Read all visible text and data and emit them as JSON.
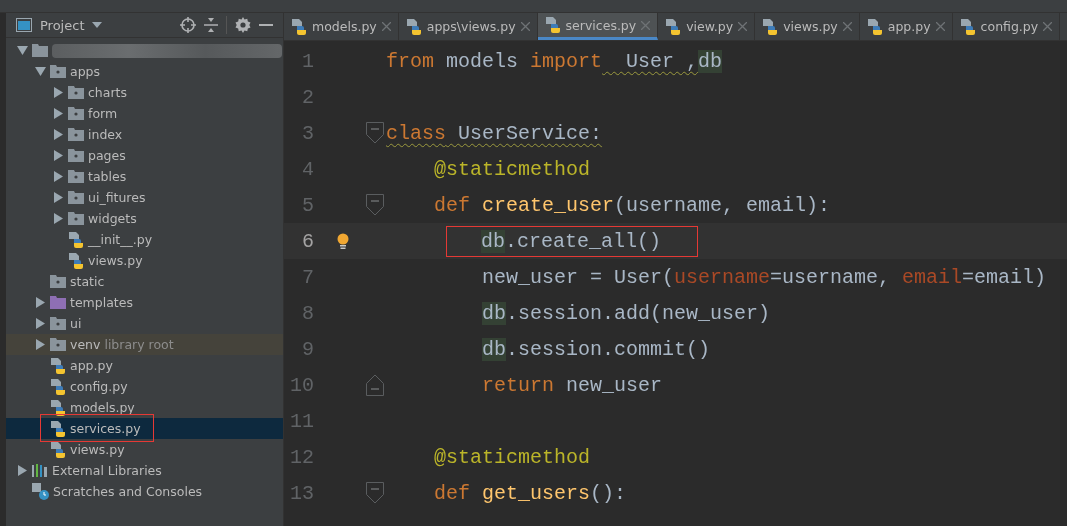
{
  "project_panel": {
    "title": "Project"
  },
  "tree": [
    {
      "kind": "redacted",
      "expanded": true,
      "selected": false,
      "children": [
        {
          "kind": "folder",
          "label": "apps",
          "expanded": true,
          "selected": false,
          "children": [
            {
              "kind": "folder",
              "label": "charts",
              "expanded": false,
              "selected": false
            },
            {
              "kind": "folder",
              "label": "form",
              "expanded": false,
              "selected": false
            },
            {
              "kind": "folder",
              "label": "index",
              "expanded": false,
              "selected": false
            },
            {
              "kind": "folder",
              "label": "pages",
              "expanded": false,
              "selected": false
            },
            {
              "kind": "folder",
              "label": "tables",
              "expanded": false,
              "selected": false
            },
            {
              "kind": "folder",
              "label": "ui_fitures",
              "expanded": false,
              "selected": false
            },
            {
              "kind": "folder",
              "label": "widgets",
              "expanded": false,
              "selected": false
            },
            {
              "kind": "file",
              "label": "__init__.py",
              "selected": false
            },
            {
              "kind": "file",
              "label": "views.py",
              "selected": false
            }
          ]
        },
        {
          "kind": "folder",
          "label": "static",
          "selected": false
        },
        {
          "kind": "template-folder",
          "label": "templates",
          "expanded": false,
          "selected": false
        },
        {
          "kind": "folder",
          "label": "ui",
          "expanded": false,
          "selected": false
        },
        {
          "kind": "folder",
          "label": "venv",
          "note": "library root",
          "expanded": false,
          "selected": false
        },
        {
          "kind": "file",
          "label": "app.py",
          "selected": false
        },
        {
          "kind": "file",
          "label": "config.py",
          "selected": false
        },
        {
          "kind": "file",
          "label": "models.py",
          "selected": false
        },
        {
          "kind": "file",
          "label": "services.py",
          "selected": true,
          "annotated": true
        },
        {
          "kind": "file",
          "label": "views.py",
          "selected": false
        }
      ]
    },
    {
      "kind": "libraries",
      "label": "External Libraries",
      "expanded": false,
      "selected": false
    },
    {
      "kind": "scratches",
      "label": "Scratches and Consoles",
      "selected": false
    }
  ],
  "tabs": [
    {
      "label": "models.py",
      "selected": false
    },
    {
      "label": "apps\\views.py",
      "selected": false
    },
    {
      "label": "services.py",
      "selected": true
    },
    {
      "label": "view.py",
      "selected": false
    },
    {
      "label": "views.py",
      "selected": false
    },
    {
      "label": "app.py",
      "selected": false
    },
    {
      "label": "config.py",
      "selected": false
    }
  ],
  "code_lines": [
    {
      "number": "1",
      "tokens": [
        {
          "text": "from",
          "kind": "keyword"
        },
        {
          "text": " models ",
          "kind": "plain"
        },
        {
          "text": "import",
          "kind": "keyword"
        },
        {
          "text": "  User ,",
          "kind": "plain",
          "warn": true
        },
        {
          "text": "db",
          "kind": "usage"
        }
      ]
    },
    {
      "number": "2"
    },
    {
      "number": "3",
      "fold_start": true,
      "tokens": [
        {
          "text": "class",
          "kind": "keyword",
          "warn": true
        },
        {
          "text": " UserService:",
          "kind": "plain",
          "warn": true
        }
      ],
      "children": [
        {
          "number": "4",
          "tokens": [
            {
              "text": "@staticmethod",
              "kind": "decorator"
            }
          ]
        },
        {
          "number": "5",
          "fold_start": true,
          "tokens": [
            {
              "text": "def ",
              "kind": "keyword"
            },
            {
              "text": "create_user",
              "kind": "function"
            },
            {
              "text": "(username, email):",
              "kind": "plain"
            }
          ],
          "children": [
            {
              "number": "6",
              "current": true,
              "bulb": true,
              "annotated": true,
              "tokens": [
                {
                  "text": "db",
                  "kind": "usage"
                },
                {
                  "text": ".create_all()",
                  "kind": "plain"
                }
              ]
            },
            {
              "number": "7",
              "tokens": [
                {
                  "text": "new_user = User(",
                  "kind": "plain"
                },
                {
                  "text": "username",
                  "kind": "param"
                },
                {
                  "text": "=username, ",
                  "kind": "plain"
                },
                {
                  "text": "email",
                  "kind": "param"
                },
                {
                  "text": "=email)",
                  "kind": "plain"
                }
              ]
            },
            {
              "number": "8",
              "tokens": [
                {
                  "text": "db",
                  "kind": "usage"
                },
                {
                  "text": ".session.add(new_user)",
                  "kind": "plain"
                }
              ]
            },
            {
              "number": "9",
              "tokens": [
                {
                  "text": "db",
                  "kind": "usage"
                },
                {
                  "text": ".session.commit()",
                  "kind": "plain"
                }
              ]
            },
            {
              "number": "10",
              "fold_end": true,
              "tokens": [
                {
                  "text": "return",
                  "kind": "keyword"
                },
                {
                  "text": " new_user",
                  "kind": "plain"
                }
              ]
            }
          ]
        },
        {
          "number": "11"
        },
        {
          "number": "12",
          "tokens": [
            {
              "text": "@staticmethod",
              "kind": "decorator"
            }
          ]
        },
        {
          "number": "13",
          "fold_start": true,
          "tokens": [
            {
              "text": "def ",
              "kind": "keyword"
            },
            {
              "text": "get_users",
              "kind": "function"
            },
            {
              "text": "():",
              "kind": "plain"
            }
          ]
        }
      ]
    }
  ]
}
